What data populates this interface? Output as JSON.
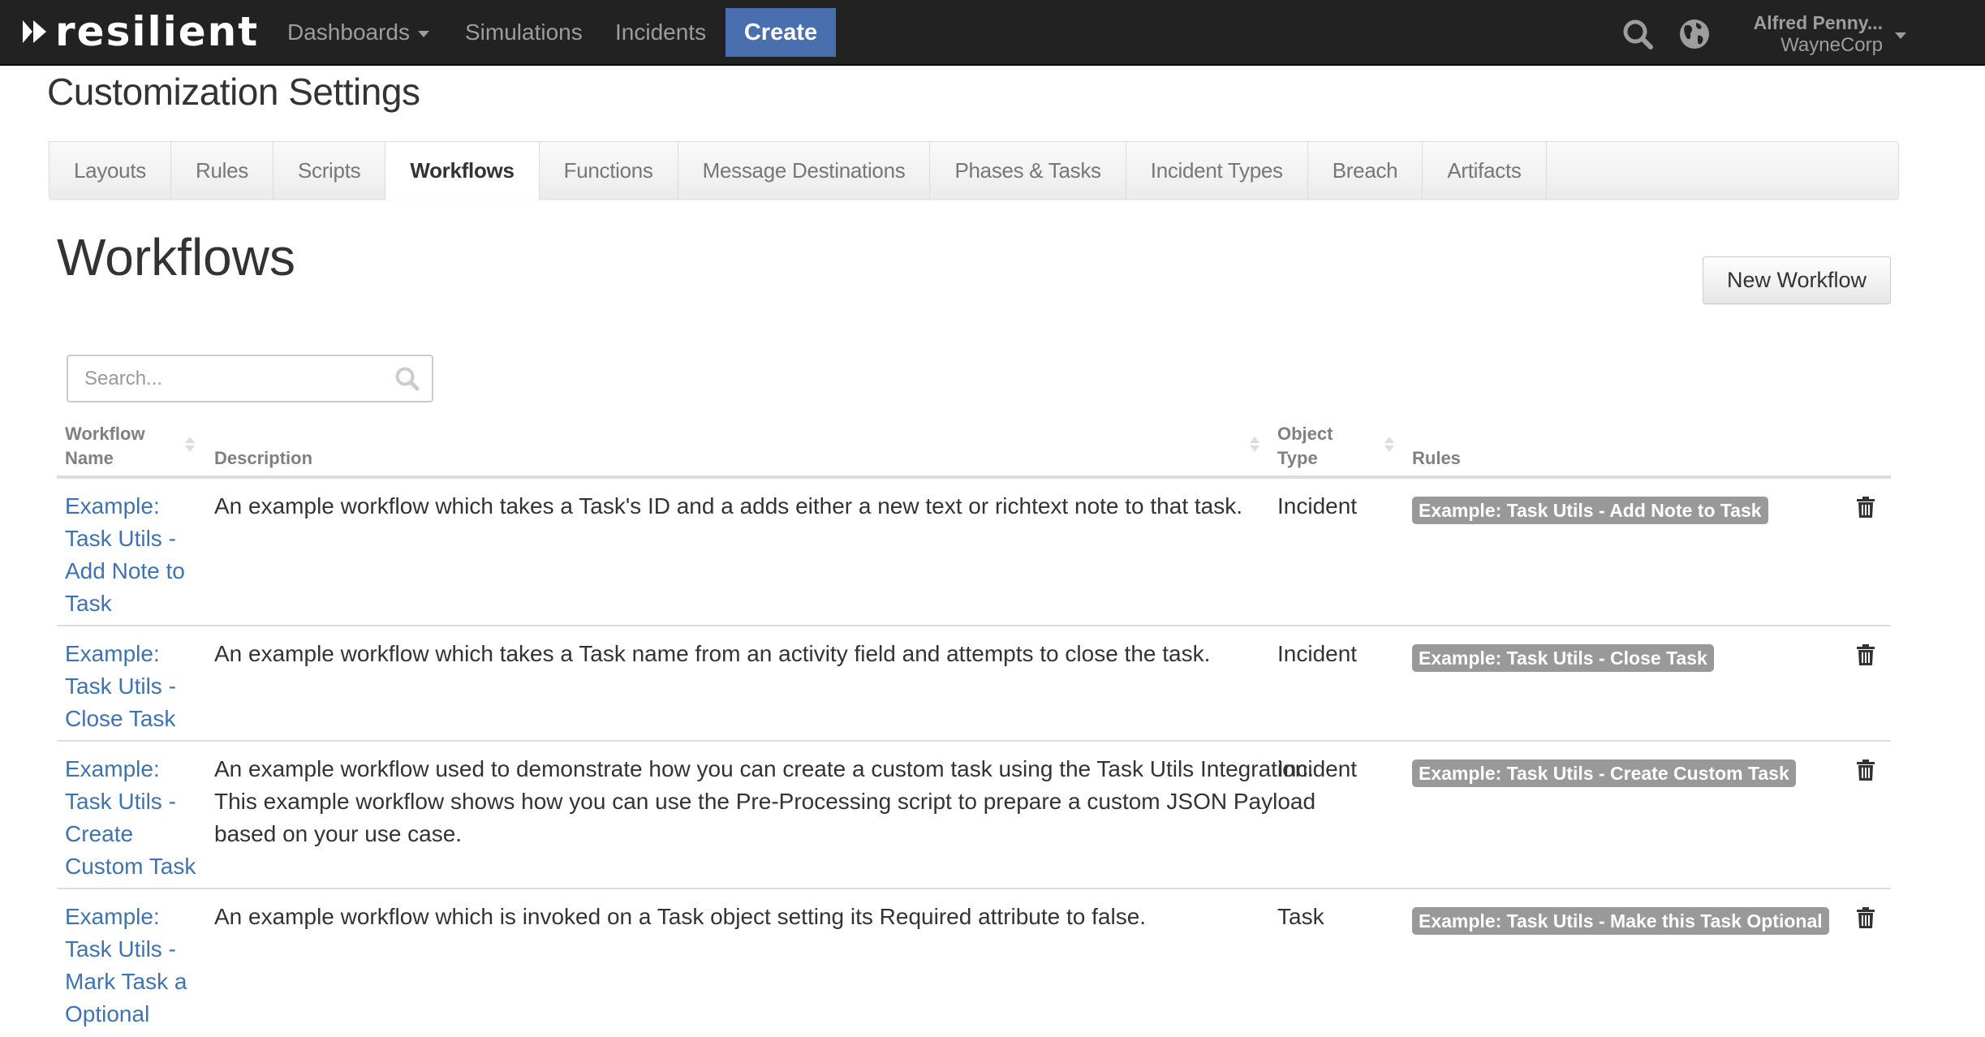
{
  "nav": {
    "logo_text": "resilient",
    "links": [
      {
        "label": "Dashboards",
        "has_dropdown": true
      },
      {
        "label": "Simulations"
      },
      {
        "label": "Incidents"
      }
    ],
    "create_label": "Create",
    "user": {
      "name": "Alfred Penny...",
      "org": "WayneCorp"
    },
    "icons": {
      "search": "search-icon",
      "globe": "globe-icon"
    },
    "colors": {
      "bar": "#222222",
      "create": "#4a6fae",
      "link": "#9d9d9d"
    }
  },
  "page": {
    "title": "Customization Settings",
    "tabs": [
      {
        "label": "Layouts"
      },
      {
        "label": "Rules"
      },
      {
        "label": "Scripts"
      },
      {
        "label": "Workflows",
        "active": true
      },
      {
        "label": "Functions"
      },
      {
        "label": "Message Destinations"
      },
      {
        "label": "Phases & Tasks"
      },
      {
        "label": "Incident Types"
      },
      {
        "label": "Breach"
      },
      {
        "label": "Artifacts"
      }
    ]
  },
  "workflows": {
    "heading": "Workflows",
    "new_button": "New Workflow",
    "search": {
      "placeholder": "Search...",
      "value": ""
    },
    "columns": {
      "name_line1": "Workflow",
      "name_line2": "Name",
      "description": "Description",
      "type_line1": "Object",
      "type_line2": "Type",
      "rules": "Rules"
    },
    "rows": [
      {
        "name": "Example: Task Utils - Add Note to Task",
        "description": "An example workflow which takes a Task's ID and a adds either a new text or richtext note to that task.",
        "object_type": "Incident",
        "rule": "Example: Task Utils - Add Note to Task"
      },
      {
        "name": "Example: Task Utils - Close Task",
        "description": "An example workflow which takes a Task name from an activity field and attempts to close the task.",
        "object_type": "Incident",
        "rule": "Example: Task Utils - Close Task"
      },
      {
        "name": "Example: Task Utils - Create Custom Task",
        "description": "An example workflow used to demonstrate how you can create a custom task using the Task Utils Integration. This example workflow shows how you can use the Pre-Processing script to prepare a custom JSON Payload based on your use case.",
        "object_type": "Incident",
        "rule": "Example: Task Utils - Create Custom Task"
      },
      {
        "name": "Example: Task Utils - Mark Task a Optional",
        "description": "An example workflow which is invoked on a Task object setting its Required attribute to false.",
        "object_type": "Task",
        "rule": "Example: Task Utils - Make this Task Optional"
      }
    ],
    "colors": {
      "link": "#3f73b0",
      "badge": "#999999"
    }
  }
}
